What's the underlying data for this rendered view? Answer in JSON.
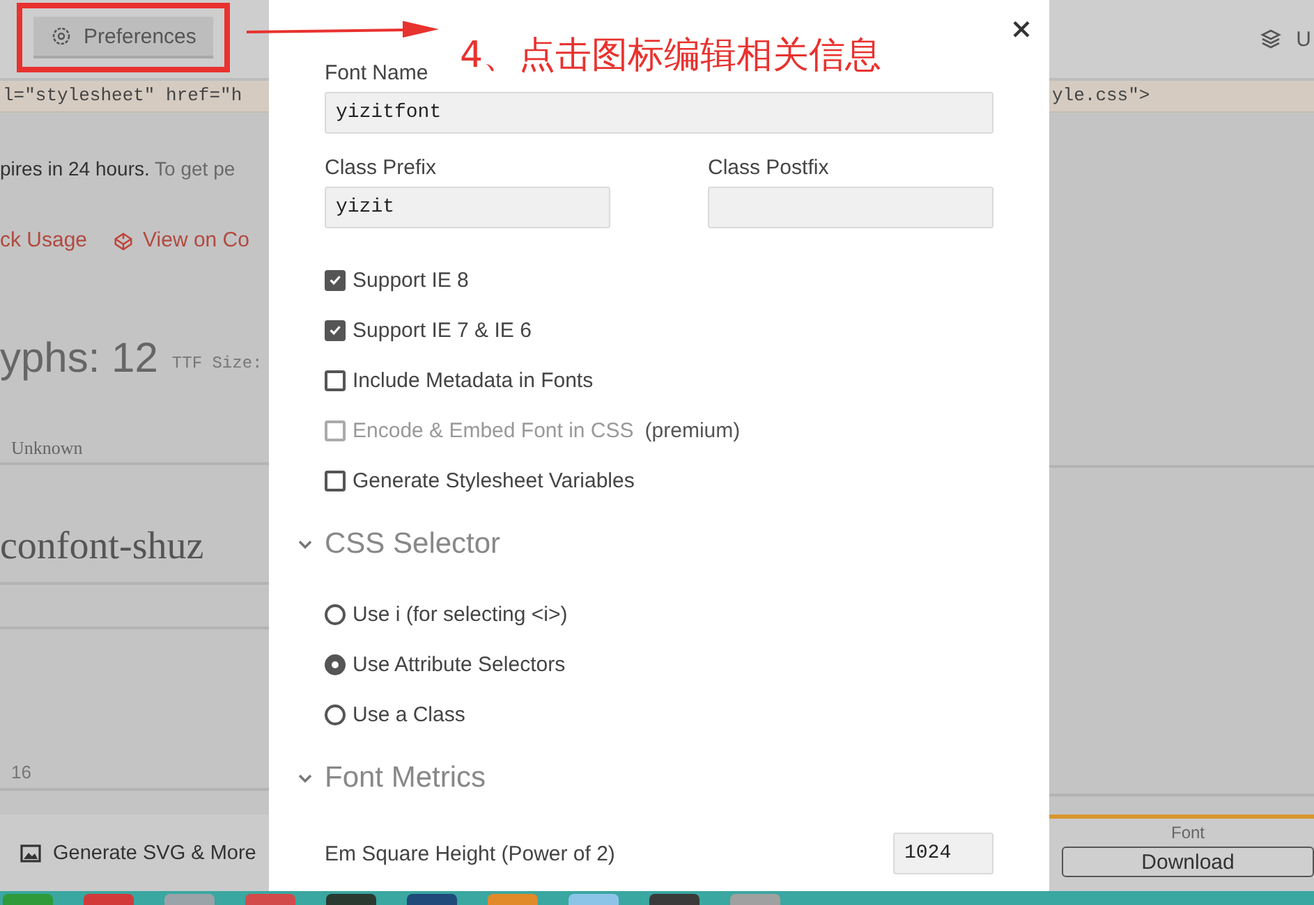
{
  "toolbar": {
    "preferences_button": "Preferences",
    "user_menu": "U"
  },
  "code_line": {
    "left": "l=\"stylesheet\" href=\"h",
    "right": "yle.css\">"
  },
  "notice": {
    "strong": "pires in 24 hours.",
    "rest": "To get pe"
  },
  "links": {
    "usage": "ck Usage",
    "codepen": "View on Co"
  },
  "stats": {
    "glyphs": "yphs: 12",
    "ttf_size": "TTF Size:"
  },
  "glyph_table": {
    "column_1": "Unknown",
    "glyph_name": "confont-shuz",
    "size": "16"
  },
  "bottom_bar": {
    "generate_button": "Generate SVG & More",
    "font_tab": "Font",
    "download_button": "Download"
  },
  "annotation": {
    "text": "4、点击图标编辑相关信息"
  },
  "dialog": {
    "fields": [
      {
        "label": "Font Name",
        "value": "yizitfont"
      },
      {
        "label": "Class Prefix",
        "value": "yizit"
      },
      {
        "label": "Class Postfix"
      }
    ],
    "options": [
      {
        "label": "Support IE 8",
        "checked": true,
        "disabled": false
      },
      {
        "label": "Support IE 7 & IE 6",
        "checked": true,
        "disabled": false
      },
      {
        "label": "Include Metadata in Fonts",
        "checked": false,
        "disabled": false
      },
      {
        "label": "Encode & Embed Font in CSS",
        "note": "(premium)",
        "checked": false,
        "disabled": true
      },
      {
        "label": "Generate Stylesheet Variables",
        "checked": false,
        "disabled": false
      }
    ],
    "sections": [
      {
        "title": "CSS Selector",
        "expanded": true,
        "kind": "radios",
        "items": [
          {
            "label": "Use i (for selecting <i>)",
            "selected": false
          },
          {
            "label": "Use Attribute Selectors",
            "selected": true
          },
          {
            "label": "Use a Class",
            "selected": false
          }
        ]
      },
      {
        "title": "Font Metrics",
        "expanded": true,
        "kind": "fields",
        "items": [
          {
            "label": "Em Square Height (Power of 2)",
            "value": "1024"
          }
        ]
      }
    ]
  }
}
